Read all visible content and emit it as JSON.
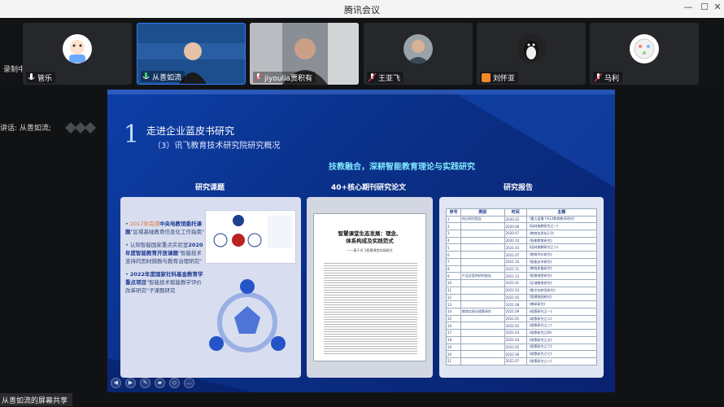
{
  "window": {
    "title": "腾讯会议"
  },
  "status": {
    "recording": "录制中",
    "speaking": "讲话: 从善如流;",
    "share_label": "从善如流的屏幕共享"
  },
  "participants": [
    {
      "name": "管乐",
      "avatar": "cartoon-avatar"
    },
    {
      "name": "从善如流",
      "avatar": "video-speaker"
    },
    {
      "name": "jiyoulia贾积有",
      "avatar": "video-man"
    },
    {
      "name": "王亚飞",
      "avatar": "photo-man"
    },
    {
      "name": "刘怀亚",
      "avatar": "person-icon"
    },
    {
      "name": "马利",
      "avatar": "cartoon-avatar"
    }
  ],
  "slide": {
    "number": "1",
    "title": "走进企业蓝皮书研究",
    "subtitle": "（3）讯飞教育技术研究院研究概况",
    "headline": "技教融合，深耕智能教育理论与实践研究",
    "columns": [
      "研究课题",
      "40+核心期刊研究论文",
      "研究报告"
    ],
    "bullets": [
      {
        "year": "2017年完成",
        "strong": "中央电教馆委托课题",
        "text": "\"区域基础教育信息化工作指南\""
      },
      {
        "year": "认知智能国家重点实验室",
        "strong": "2020年度智能教育开放课题",
        "text": "\"智能技术支持的因材施教与教育治理研究\""
      },
      {
        "year": "",
        "strong": "2022年度国家社科基金教育学重点项目",
        "text": "\"智能技术赋能教学评价改革研究\"子课题研究"
      }
    ],
    "paper": {
      "title_l1": "智慧课堂生态发展：理念、",
      "title_l2": "体系构成及实践范式",
      "subtitle": "——基于讯飞智慧课堂实践研究"
    },
    "report_table": {
      "headers": [
        "序号",
        "类别",
        "时间",
        "主题"
      ],
      "rows": [
        [
          "1",
          "热点研究报告",
          "2020.02",
          "《重大疫情下K12教育教学研究》"
        ],
        [
          "2",
          "",
          "2020.06",
          "《因材施教研究之一》"
        ],
        [
          "3",
          "",
          "2020.07",
          "《教育信息化2.0》"
        ],
        [
          "4",
          "",
          "2020.10",
          "《智能教育研究》"
        ],
        [
          "5",
          "",
          "2021.03",
          "《因材施教研究之二》"
        ],
        [
          "6",
          "",
          "2021.07",
          "《教育评价研究》"
        ],
        [
          "7",
          "",
          "2021.10",
          "《智能技术研究》"
        ],
        [
          "8",
          "",
          "2021.11",
          "《教育质量研究》"
        ],
        [
          "9",
          "产品及案例研究报告",
          "2021.12",
          "《智慧课堂研究》"
        ],
        [
          "10",
          "",
          "2022.01",
          "《区域教育研究》"
        ],
        [
          "11",
          "",
          "2022.03",
          "《数字化转型研究》"
        ],
        [
          "12",
          "",
          "2021.05",
          "《智慧校园研究》"
        ],
        [
          "13",
          "",
          "2021.08",
          "《教研研究》"
        ],
        [
          "14",
          "教育信息化政策研究",
          "2021.09",
          "《政策研究之一》"
        ],
        [
          "15",
          "",
          "2022.01",
          "《政策研究之二》"
        ],
        [
          "16",
          "",
          "2022.02",
          "《政策研究之三》"
        ],
        [
          "17",
          "",
          "2022.03",
          "《政策研究之四》"
        ],
        [
          "18",
          "",
          "2022.04",
          "《政策研究之五》"
        ],
        [
          "19",
          "",
          "2022.05",
          "《政策研究之六》"
        ],
        [
          "20",
          "",
          "2022.06",
          "《政策研究之七》"
        ],
        [
          "21",
          "",
          "2022.07",
          "《政策研究之八》"
        ]
      ]
    }
  }
}
